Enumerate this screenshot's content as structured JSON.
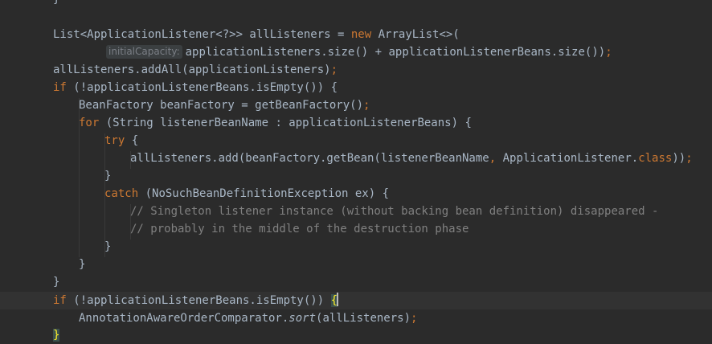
{
  "editor": {
    "lines": [
      {
        "id": "l0",
        "text": "}"
      },
      {
        "id": "l1a",
        "text": "List<ApplicationListener<?>> allListeners = "
      },
      {
        "id": "l1b",
        "text": "new"
      },
      {
        "id": "l1c",
        "text": " ArrayList<>("
      },
      {
        "id": "l2hint",
        "text": "initialCapacity:"
      },
      {
        "id": "l2a",
        "text": "applicationListeners.size() + applicationListenerBeans.size())"
      },
      {
        "id": "l2b",
        "text": ";"
      },
      {
        "id": "l3a",
        "text": "allListeners.addAll(applicationListeners)"
      },
      {
        "id": "l3b",
        "text": ";"
      },
      {
        "id": "l4a",
        "text": "if"
      },
      {
        "id": "l4b",
        "text": " (!applicationListenerBeans.isEmpty()) {"
      },
      {
        "id": "l5a",
        "text": "BeanFactory beanFactory = getBeanFactory()"
      },
      {
        "id": "l5b",
        "text": ";"
      },
      {
        "id": "l6a",
        "text": "for"
      },
      {
        "id": "l6b",
        "text": " (String listenerBeanName : applicationListenerBeans) {"
      },
      {
        "id": "l7a",
        "text": "try"
      },
      {
        "id": "l7b",
        "text": " {"
      },
      {
        "id": "l8a",
        "text": "allListeners.add(beanFactory.getBean(listenerBeanName"
      },
      {
        "id": "l8b",
        "text": ","
      },
      {
        "id": "l8c",
        "text": " ApplicationListener."
      },
      {
        "id": "l8d",
        "text": "class"
      },
      {
        "id": "l8e",
        "text": "))"
      },
      {
        "id": "l8f",
        "text": ";"
      },
      {
        "id": "l9",
        "text": "}"
      },
      {
        "id": "l10a",
        "text": "catch"
      },
      {
        "id": "l10b",
        "text": " (NoSuchBeanDefinitionException ex) {"
      },
      {
        "id": "l11",
        "text": "// Singleton listener instance (without backing bean definition) disappeared -"
      },
      {
        "id": "l12",
        "text": "// probably in the middle of the destruction phase"
      },
      {
        "id": "l13",
        "text": "}"
      },
      {
        "id": "l14",
        "text": "}"
      },
      {
        "id": "l15",
        "text": "}"
      },
      {
        "id": "l16a",
        "text": "if"
      },
      {
        "id": "l16b",
        "text": " (!applicationListenerBeans.isEmpty()) "
      },
      {
        "id": "l16c",
        "text": "{"
      },
      {
        "id": "l17a",
        "text": "AnnotationAwareOrderComparator."
      },
      {
        "id": "l17b",
        "text": "sort"
      },
      {
        "id": "l17c",
        "text": "(allListeners)"
      },
      {
        "id": "l17d",
        "text": ";"
      },
      {
        "id": "l18",
        "text": "}"
      }
    ]
  },
  "colors": {
    "background": "#2b2b2b",
    "text": "#a9b7c6",
    "keyword": "#cc7832",
    "comment": "#808080",
    "brace_match": "#ffef28",
    "current_line": "#323232"
  }
}
